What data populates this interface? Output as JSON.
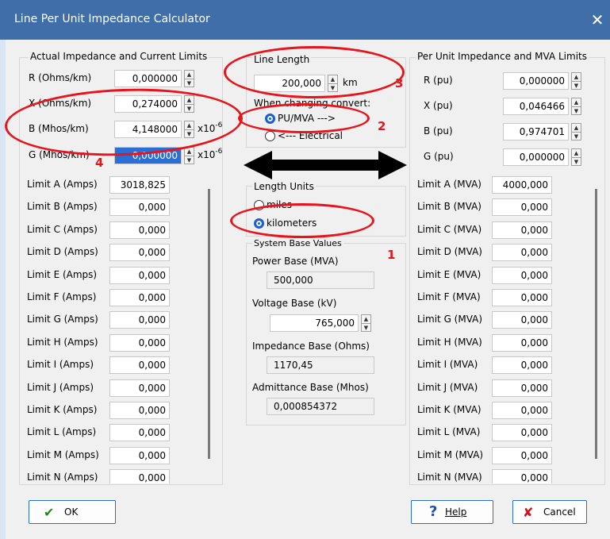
{
  "window": {
    "title": "Line Per Unit Impedance Calculator",
    "close_glyph": "✕"
  },
  "actual": {
    "title": "Actual Impedance and Current Limits",
    "params": [
      {
        "label": "R (Ohms/km)",
        "value": "0,000000",
        "unit": ""
      },
      {
        "label": "X (Ohms/km)",
        "value": "0,274000",
        "unit": ""
      },
      {
        "label": "B (Mhos/km)",
        "value": "4,148000",
        "unit": "x10",
        "exp": "-6"
      },
      {
        "label": "G (Mhos/km)",
        "value": "0,000000",
        "unit": "x10",
        "exp": "-6"
      }
    ],
    "limits": [
      {
        "label": "Limit A (Amps)",
        "value": "3018,825"
      },
      {
        "label": "Limit B (Amps)",
        "value": "0,000"
      },
      {
        "label": "Limit C (Amps)",
        "value": "0,000"
      },
      {
        "label": "Limit D (Amps)",
        "value": "0,000"
      },
      {
        "label": "Limit E (Amps)",
        "value": "0,000"
      },
      {
        "label": "Limit F (Amps)",
        "value": "0,000"
      },
      {
        "label": "Limit G (Amps)",
        "value": "0,000"
      },
      {
        "label": "Limit H (Amps)",
        "value": "0,000"
      },
      {
        "label": "Limit I (Amps)",
        "value": "0,000"
      },
      {
        "label": "Limit J (Amps)",
        "value": "0,000"
      },
      {
        "label": "Limit K (Amps)",
        "value": "0,000"
      },
      {
        "label": "Limit L (Amps)",
        "value": "0,000"
      },
      {
        "label": "Limit M (Amps)",
        "value": "0,000"
      },
      {
        "label": "Limit N (Amps)",
        "value": "0,000"
      }
    ]
  },
  "line_length": {
    "title": "Line Length",
    "value": "200,000",
    "unit": "km",
    "convert_label": "When changing convert:",
    "options": [
      "PU/MVA --->",
      "<--- Electrical"
    ],
    "selected": "PU/MVA --->"
  },
  "length_units": {
    "title": "Length Units",
    "options": [
      "miles",
      "kilometers"
    ],
    "selected": "kilometers"
  },
  "system_base": {
    "title": "System Base Values",
    "power_label": "Power Base (MVA)",
    "power_value": "500,000",
    "voltage_label": "Voltage Base (kV)",
    "voltage_value": "765,000",
    "impedance_label": "Impedance Base (Ohms)",
    "impedance_value": "1170,45",
    "admittance_label": "Admittance Base (Mhos)",
    "admittance_value": "0,000854372"
  },
  "perunit": {
    "title": "Per Unit Impedance and MVA Limits",
    "params": [
      {
        "label": "R (pu)",
        "value": "0,000000"
      },
      {
        "label": "X (pu)",
        "value": "0,046466"
      },
      {
        "label": "B (pu)",
        "value": "0,974701"
      },
      {
        "label": "G (pu)",
        "value": "0,000000"
      }
    ],
    "limits": [
      {
        "label": "Limit A (MVA)",
        "value": "4000,000"
      },
      {
        "label": "Limit B (MVA)",
        "value": "0,000"
      },
      {
        "label": "Limit C (MVA)",
        "value": "0,000"
      },
      {
        "label": "Limit D (MVA)",
        "value": "0,000"
      },
      {
        "label": "Limit E (MVA)",
        "value": "0,000"
      },
      {
        "label": "Limit F (MVA)",
        "value": "0,000"
      },
      {
        "label": "Limit G (MVA)",
        "value": "0,000"
      },
      {
        "label": "Limit H (MVA)",
        "value": "0,000"
      },
      {
        "label": "Limit I (MVA)",
        "value": "0,000"
      },
      {
        "label": "Limit J (MVA)",
        "value": "0,000"
      },
      {
        "label": "Limit K (MVA)",
        "value": "0,000"
      },
      {
        "label": "Limit L (MVA)",
        "value": "0,000"
      },
      {
        "label": "Limit M (MVA)",
        "value": "0,000"
      },
      {
        "label": "Limit N (MVA)",
        "value": "0,000"
      }
    ]
  },
  "buttons": {
    "ok": "OK",
    "ok_icon": "check-icon",
    "help": "Help",
    "help_icon": "question-icon",
    "cancel": "Cancel",
    "cancel_icon": "x-mark-icon"
  },
  "annotations": [
    "1",
    "2",
    "3",
    "4"
  ],
  "colors": {
    "titlebar": "#3f6ea9",
    "annotation": "#e8141b",
    "selection": "#2a6fd6"
  }
}
